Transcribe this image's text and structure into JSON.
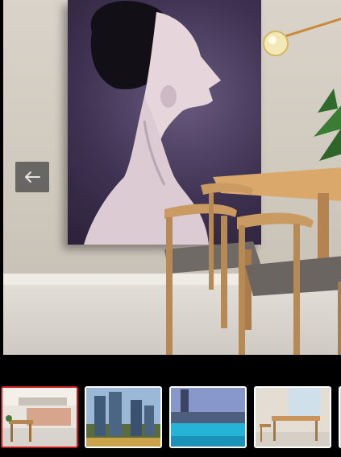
{
  "gallery": {
    "main_image": {
      "icon": "interior-dining-room-photo",
      "alt_semantic": "dining-room-with-portrait-poster"
    },
    "prev_button": {
      "icon": "arrow-left-icon"
    },
    "thumbnails": [
      {
        "icon": "kitchen-dining-photo",
        "active": true
      },
      {
        "icon": "tower-buildings-photo",
        "active": false
      },
      {
        "icon": "rooftop-pool-photo",
        "active": false
      },
      {
        "icon": "dining-table-photo",
        "active": false
      },
      {
        "icon": "partial-thumbnail",
        "active": false
      }
    ]
  },
  "colors": {
    "active_thumb_border": "#c81c1c",
    "thumb_border": "#ffffff",
    "background": "#000000"
  }
}
